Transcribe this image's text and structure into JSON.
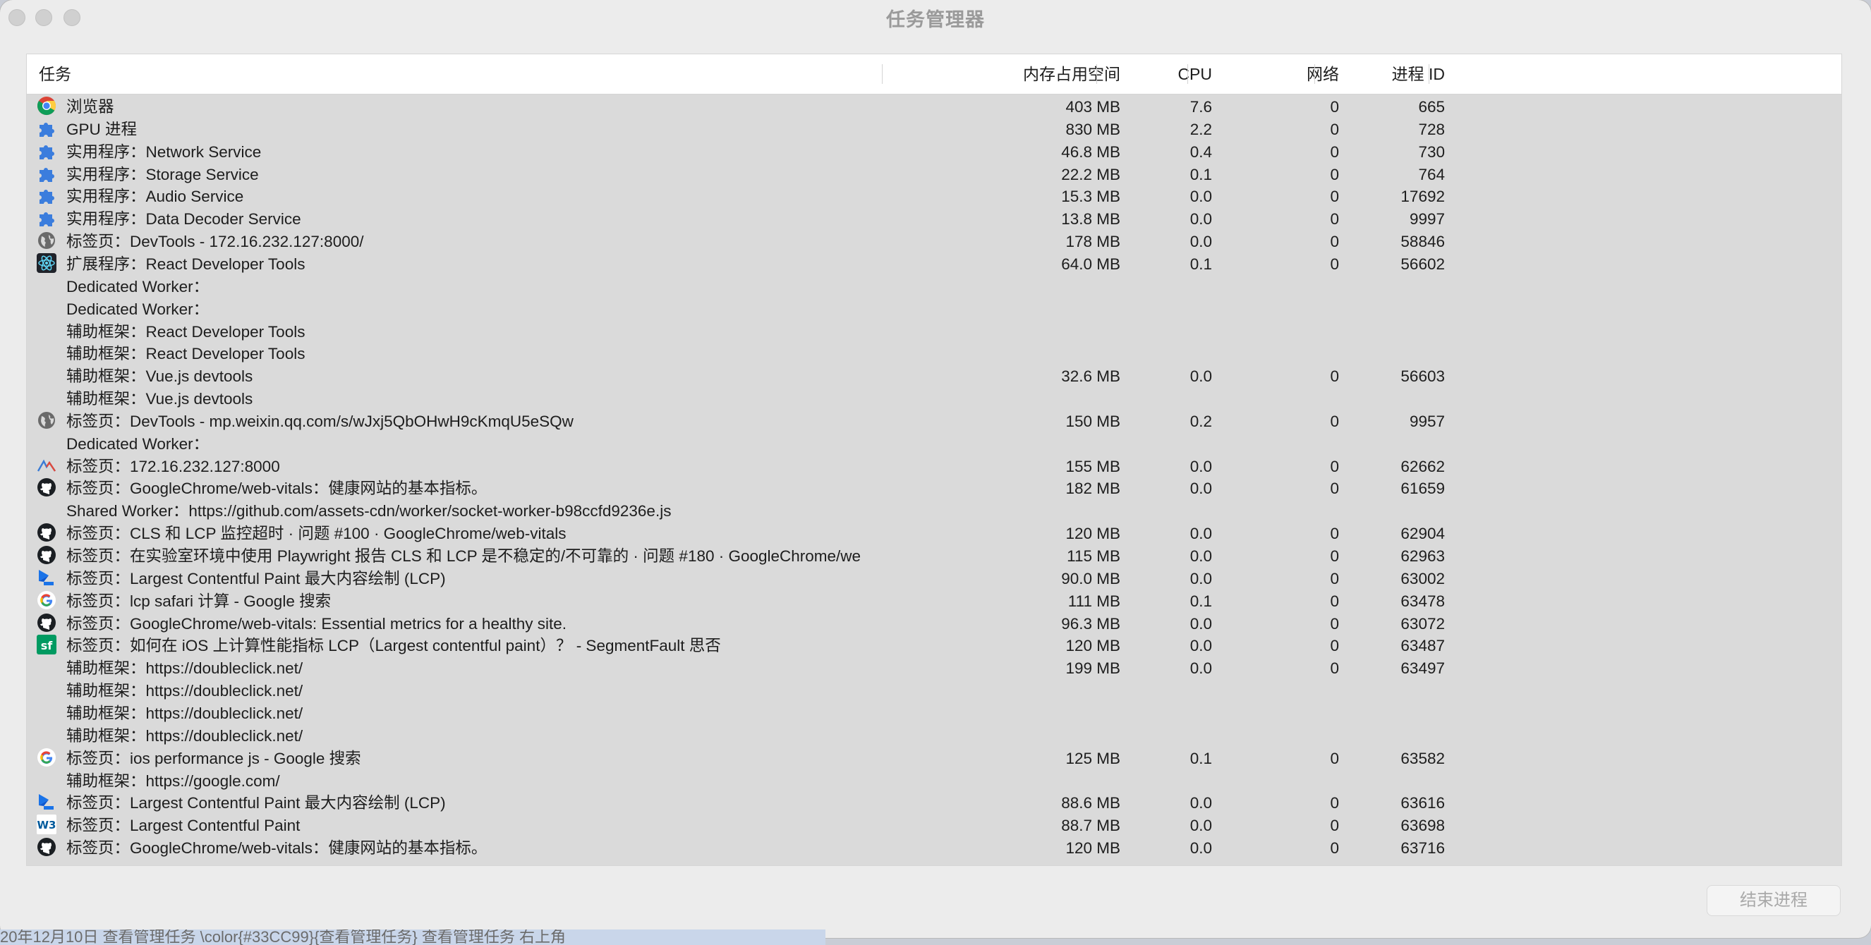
{
  "window": {
    "title": "任务管理器"
  },
  "columns": {
    "task": "任务",
    "memory": "内存占用空间",
    "cpu": "CPU",
    "network": "网络",
    "pid": "进程 ID"
  },
  "rows": [
    {
      "icon": "chrome-icon",
      "task": "浏览器",
      "memory": "403 MB",
      "cpu": "7.6",
      "network": "0",
      "pid": "665"
    },
    {
      "icon": "extension-puzzle-icon",
      "task": "GPU 进程",
      "memory": "830 MB",
      "cpu": "2.2",
      "network": "0",
      "pid": "728"
    },
    {
      "icon": "extension-puzzle-icon",
      "task": "实用程序：Network Service",
      "memory": "46.8 MB",
      "cpu": "0.4",
      "network": "0",
      "pid": "730"
    },
    {
      "icon": "extension-puzzle-icon",
      "task": "实用程序：Storage Service",
      "memory": "22.2 MB",
      "cpu": "0.1",
      "network": "0",
      "pid": "764"
    },
    {
      "icon": "extension-puzzle-icon",
      "task": "实用程序：Audio Service",
      "memory": "15.3 MB",
      "cpu": "0.0",
      "network": "0",
      "pid": "17692"
    },
    {
      "icon": "extension-puzzle-icon",
      "task": "实用程序：Data Decoder Service",
      "memory": "13.8 MB",
      "cpu": "0.0",
      "network": "0",
      "pid": "9997"
    },
    {
      "icon": "globe-icon",
      "task": "标签页：DevTools - 172.16.232.127:8000/",
      "memory": "178 MB",
      "cpu": "0.0",
      "network": "0",
      "pid": "58846"
    },
    {
      "icon": "react-icon",
      "task": "扩展程序：React Developer Tools",
      "memory": "64.0 MB",
      "cpu": "0.1",
      "network": "0",
      "pid": "56602"
    },
    {
      "icon": "",
      "task": "Dedicated Worker：",
      "memory": "",
      "cpu": "",
      "network": "",
      "pid": ""
    },
    {
      "icon": "",
      "task": "Dedicated Worker：",
      "memory": "",
      "cpu": "",
      "network": "",
      "pid": ""
    },
    {
      "icon": "",
      "task": "辅助框架：React Developer Tools",
      "memory": "",
      "cpu": "",
      "network": "",
      "pid": ""
    },
    {
      "icon": "",
      "task": "辅助框架：React Developer Tools",
      "memory": "",
      "cpu": "",
      "network": "",
      "pid": ""
    },
    {
      "icon": "",
      "task": "辅助框架：Vue.js devtools",
      "memory": "32.6 MB",
      "cpu": "0.0",
      "network": "0",
      "pid": "56603"
    },
    {
      "icon": "",
      "task": "辅助框架：Vue.js devtools",
      "memory": "",
      "cpu": "",
      "network": "",
      "pid": ""
    },
    {
      "icon": "globe-icon",
      "task": "标签页：DevTools - mp.weixin.qq.com/s/wJxj5QbOHwH9cKmqU5eSQw",
      "memory": "150 MB",
      "cpu": "0.2",
      "network": "0",
      "pid": "9957"
    },
    {
      "icon": "",
      "task": "Dedicated Worker：",
      "memory": "",
      "cpu": "",
      "network": "",
      "pid": ""
    },
    {
      "icon": "vite-logo-icon",
      "task": "标签页：172.16.232.127:8000",
      "memory": "155 MB",
      "cpu": "0.0",
      "network": "0",
      "pid": "62662"
    },
    {
      "icon": "github-icon",
      "task": "标签页：GoogleChrome/web-vitals：健康网站的基本指标。",
      "memory": "182 MB",
      "cpu": "0.0",
      "network": "0",
      "pid": "61659"
    },
    {
      "icon": "",
      "task": "Shared Worker：https://github.com/assets-cdn/worker/socket-worker-b98ccfd9236e.js",
      "memory": "",
      "cpu": "",
      "network": "",
      "pid": ""
    },
    {
      "icon": "github-icon",
      "task": "标签页：CLS 和 LCP 监控超时 · 问题 #100 · GoogleChrome/web-vitals",
      "memory": "120 MB",
      "cpu": "0.0",
      "network": "0",
      "pid": "62904"
    },
    {
      "icon": "github-icon",
      "task": "标签页：在实验室环境中使用 Playwright 报告 CLS 和 LCP 是不稳定的/不可靠的 · 问题 #180 · GoogleChrome/we",
      "memory": "115 MB",
      "cpu": "0.0",
      "network": "0",
      "pid": "62963"
    },
    {
      "icon": "web-dev-icon",
      "task": "标签页：Largest Contentful Paint 最大内容绘制 (LCP)",
      "memory": "90.0 MB",
      "cpu": "0.0",
      "network": "0",
      "pid": "63002"
    },
    {
      "icon": "google-icon",
      "task": "标签页：lcp safari 计算 - Google 搜索",
      "memory": "111 MB",
      "cpu": "0.1",
      "network": "0",
      "pid": "63478"
    },
    {
      "icon": "github-icon",
      "task": "标签页：GoogleChrome/web-vitals: Essential metrics for a healthy site.",
      "memory": "96.3 MB",
      "cpu": "0.0",
      "network": "0",
      "pid": "63072"
    },
    {
      "icon": "segmentfault-icon",
      "task": "标签页：如何在 iOS 上计算性能指标 LCP（Largest contentful paint）？ - SegmentFault 思否",
      "memory": "120 MB",
      "cpu": "0.0",
      "network": "0",
      "pid": "63487"
    },
    {
      "icon": "",
      "task": "辅助框架：https://doubleclick.net/",
      "memory": "199 MB",
      "cpu": "0.0",
      "network": "0",
      "pid": "63497"
    },
    {
      "icon": "",
      "task": "辅助框架：https://doubleclick.net/",
      "memory": "",
      "cpu": "",
      "network": "",
      "pid": ""
    },
    {
      "icon": "",
      "task": "辅助框架：https://doubleclick.net/",
      "memory": "",
      "cpu": "",
      "network": "",
      "pid": ""
    },
    {
      "icon": "",
      "task": "辅助框架：https://doubleclick.net/",
      "memory": "",
      "cpu": "",
      "network": "",
      "pid": ""
    },
    {
      "icon": "google-icon",
      "task": "标签页：ios performance js - Google 搜索",
      "memory": "125 MB",
      "cpu": "0.1",
      "network": "0",
      "pid": "63582"
    },
    {
      "icon": "",
      "task": "辅助框架：https://google.com/",
      "memory": "",
      "cpu": "",
      "network": "",
      "pid": ""
    },
    {
      "icon": "web-dev-icon",
      "task": "标签页：Largest Contentful Paint 最大内容绘制 (LCP)",
      "memory": "88.6 MB",
      "cpu": "0.0",
      "network": "0",
      "pid": "63616"
    },
    {
      "icon": "w3c-icon",
      "task": "标签页：Largest Contentful Paint",
      "memory": "88.7 MB",
      "cpu": "0.0",
      "network": "0",
      "pid": "63698"
    },
    {
      "icon": "github-icon",
      "task": "标签页：GoogleChrome/web-vitals：健康网站的基本指标。",
      "memory": "120 MB",
      "cpu": "0.0",
      "network": "0",
      "pid": "63716"
    }
  ],
  "footer": {
    "end_process_label": "结束进程"
  },
  "background_text": "20年12月10日 查看管理任务 \\color{#33CC99}{查看管理任务} 查看管理任务 右上角"
}
